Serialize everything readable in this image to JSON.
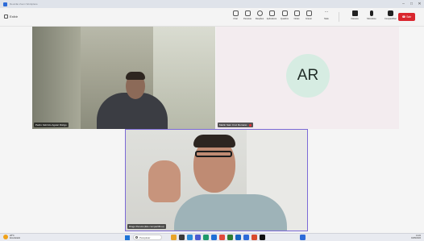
{
  "window": {
    "title": "Reunião Zoom Workplace"
  },
  "toolbar": {
    "view_label": "Exibir",
    "items": [
      {
        "label": "Chat",
        "icon": "chat-icon"
      },
      {
        "label": "Pessoas",
        "icon": "people-icon"
      },
      {
        "label": "Reações",
        "icon": "reactions-icon"
      },
      {
        "label": "Aplicativos",
        "icon": "apps-icon"
      },
      {
        "label": "Quadros",
        "icon": "whiteboards-icon"
      },
      {
        "label": "Notas",
        "icon": "notes-icon"
      },
      {
        "label": "Gravar",
        "icon": "record-icon"
      },
      {
        "label": "Mais",
        "icon": "more-icon"
      },
      {
        "label": "Câmera",
        "icon": "camera-icon"
      },
      {
        "label": "Microfone",
        "icon": "microphone-icon"
      },
      {
        "label": "Compartilhar",
        "icon": "share-icon"
      }
    ],
    "leave_label": "Sair"
  },
  "participants": [
    {
      "name": "Pedro Fabrício Aguiar Dórigo"
    },
    {
      "name": "Marlin Sain Cruz Romano",
      "initials": "AR"
    },
    {
      "name": "Diogo Pereira (Ele compartilhou)"
    }
  ],
  "taskbar": {
    "weather_temp": "28°C",
    "weather_desc": "Ensolarado",
    "search_placeholder": "Pesquisar",
    "time": "14:22",
    "date": "04/09/2024"
  }
}
